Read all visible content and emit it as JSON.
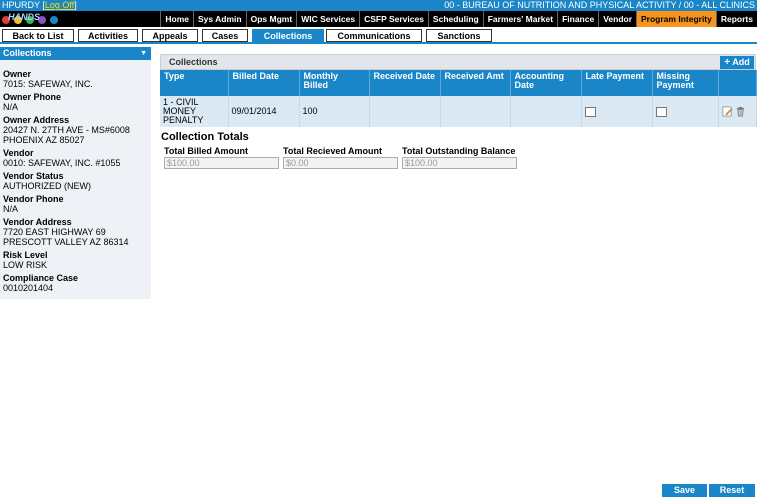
{
  "topbar": {
    "user": "HPURDY [",
    "logoff": "Log Off",
    "user_close": "]",
    "context": "00 - BUREAU OF NUTRITION AND PHYSICAL ACTIVITY / 00 - ALL CLINICS"
  },
  "logo": {
    "text": "HANDS"
  },
  "nav": [
    "Home",
    "Sys Admin",
    "Ops Mgmt",
    "WIC Services",
    "CSFP Services",
    "Scheduling",
    "Farmers' Market",
    "Finance",
    "Vendor",
    "Program Integrity",
    "Reports"
  ],
  "nav_active": "Program Integrity",
  "tabs": [
    "Back to List",
    "Activities",
    "Appeals",
    "Cases",
    "Collections",
    "Communications",
    "Sanctions"
  ],
  "sidebar": {
    "title": "Collections",
    "fields": [
      {
        "label": "Owner",
        "value": "7015: SAFEWAY, INC."
      },
      {
        "label": "Owner Phone",
        "value": "N/A"
      },
      {
        "label": "Owner Address",
        "value": "20427 N. 27TH AVE - MS#6008\nPHOENIX AZ 85027"
      },
      {
        "label": "Vendor",
        "value": "0010: SAFEWAY, INC. #1055"
      },
      {
        "label": "Vendor Status",
        "value": "AUTHORIZED (NEW)"
      },
      {
        "label": "Vendor Phone",
        "value": "N/A"
      },
      {
        "label": "Vendor Address",
        "value": "7720 EAST HIGHWAY 69\nPRESCOTT VALLEY AZ 86314"
      },
      {
        "label": "Risk Level",
        "value": "LOW RISK"
      },
      {
        "label": "Compliance Case",
        "value": "0010201404"
      }
    ]
  },
  "panel": {
    "title": "Collections",
    "add_label": "Add",
    "columns": [
      "Type",
      "Billed Date",
      "Monthly Billed",
      "Received Date",
      "Received Amt",
      "Accounting Date",
      "Late Payment",
      "Missing Payment"
    ],
    "rows": [
      {
        "type": "1 - CIVIL MONEY PENALTY",
        "billed_date": "09/01/2014",
        "monthly_billed": "100",
        "received_date": "",
        "received_amt": "",
        "accounting_date": ""
      }
    ]
  },
  "totals": {
    "title": "Collection Totals",
    "billed_label": "Total Billed Amount",
    "billed_value": "$100.00",
    "received_label": "Total Recieved Amount",
    "received_value": "$0.00",
    "outstanding_label": "Total Outstanding Balance",
    "outstanding_value": "$100.00"
  },
  "footer": {
    "save": "Save",
    "reset": "Reset"
  },
  "colors": {
    "accent": "#1a86c8",
    "active_nav": "#f7941d",
    "row_bg": "#dbe9f4"
  }
}
